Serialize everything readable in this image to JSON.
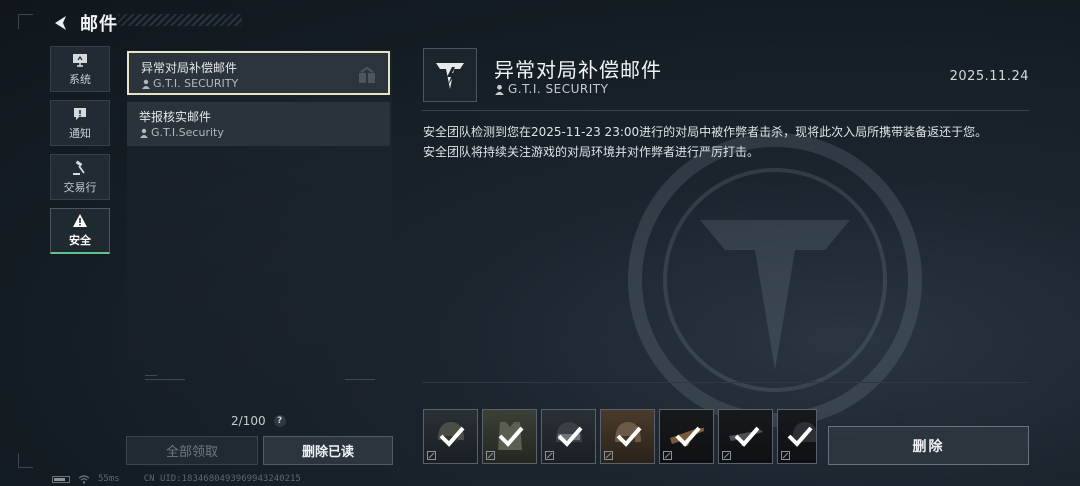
{
  "header": {
    "title": "邮件"
  },
  "sidenav": {
    "items": [
      {
        "label": "系统",
        "icon": "monitor-icon",
        "active": false
      },
      {
        "label": "通知",
        "icon": "exclamation-icon",
        "active": false
      },
      {
        "label": "交易行",
        "icon": "gavel-icon",
        "active": false
      },
      {
        "label": "安全",
        "icon": "warning-icon",
        "active": true
      }
    ]
  },
  "mail_list": {
    "items": [
      {
        "title": "异常对局补偿邮件",
        "sender": "G.T.I. SECURITY",
        "selected": true
      },
      {
        "title": "举报核实邮件",
        "sender": "G.T.I.Security",
        "selected": false
      }
    ],
    "count": "2/100",
    "help": "?",
    "claim_all_label": "全部领取",
    "delete_read_label": "删除已读"
  },
  "status": {
    "ping": "55ms",
    "uid": "CN UID:1834680493969943240215"
  },
  "detail": {
    "title": "异常对局补偿邮件",
    "sender": "G.T.I. SECURITY",
    "date": "2025.11.24",
    "body_line1": "安全团队检测到您在2025-11-23 23:00进行的对局中被作弊者击杀，现将此次入局所携带装备返还于您。",
    "body_line2": "安全团队将持续关注游戏的对局环境并对作弊者进行严厉打击。",
    "attachments": [
      {
        "name": "helmet-item",
        "claimed": true
      },
      {
        "name": "vest-item",
        "claimed": true
      },
      {
        "name": "helmet-item",
        "claimed": true
      },
      {
        "name": "helmet-item",
        "claimed": true
      },
      {
        "name": "rifle-item",
        "claimed": true
      },
      {
        "name": "rifle-item",
        "claimed": true
      },
      {
        "name": "helmet-item",
        "claimed": true
      }
    ],
    "delete_label": "删除"
  },
  "colors": {
    "accent_green": "#63c08a",
    "selected_border": "#e8e2c6"
  }
}
